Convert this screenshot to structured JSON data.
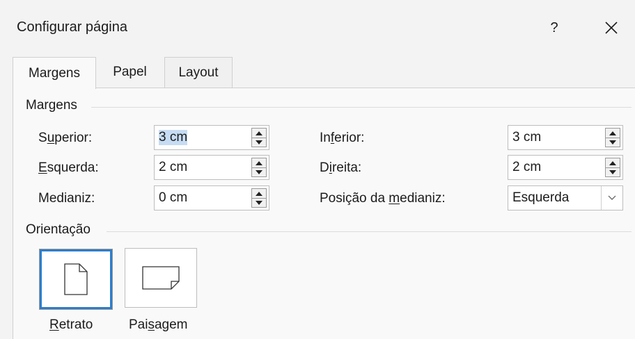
{
  "dialog": {
    "title": "Configurar página",
    "help_label": "?",
    "close_label": "✕"
  },
  "tabs": [
    {
      "label": "Margens",
      "active": true
    },
    {
      "label": "Papel",
      "active": false
    },
    {
      "label": "Layout",
      "active": false
    }
  ],
  "margins_group": {
    "label": "Margens",
    "superior": {
      "label_pre": "S",
      "label_u": "u",
      "label_post": "perior:",
      "value": "3 cm",
      "selected": true
    },
    "inferior": {
      "label_pre": "In",
      "label_u": "f",
      "label_post": "erior:",
      "value": "3 cm"
    },
    "esquerda": {
      "label_pre": "",
      "label_u": "E",
      "label_post": "squerda:",
      "value": "2 cm"
    },
    "direita": {
      "label_pre": "D",
      "label_u": "i",
      "label_post": "reita:",
      "value": "2 cm"
    },
    "medianiz": {
      "label_pre": "Medianiz",
      "label_u": "",
      "label_post": ":",
      "value": "0 cm"
    },
    "posicao_medianiz": {
      "label_pre": "Posição da ",
      "label_u": "m",
      "label_post": "edianiz:",
      "value": "Esquerda"
    }
  },
  "orientation_group": {
    "label": "Orientação",
    "retrato": {
      "label_u": "R",
      "label_post": "etrato",
      "selected": true
    },
    "paisagem": {
      "label_pre": "Pai",
      "label_u": "s",
      "label_post": "agem",
      "selected": false
    }
  },
  "colors": {
    "selection_border": "#2d7dcc",
    "text_selection": "#c6dcf2"
  },
  "icons": {
    "help": "question-mark",
    "close": "x-close",
    "portrait": "portrait-page-icon",
    "landscape": "landscape-page-icon",
    "spin_up": "triangle-up",
    "spin_down": "triangle-down",
    "dropdown": "chevron-down"
  }
}
